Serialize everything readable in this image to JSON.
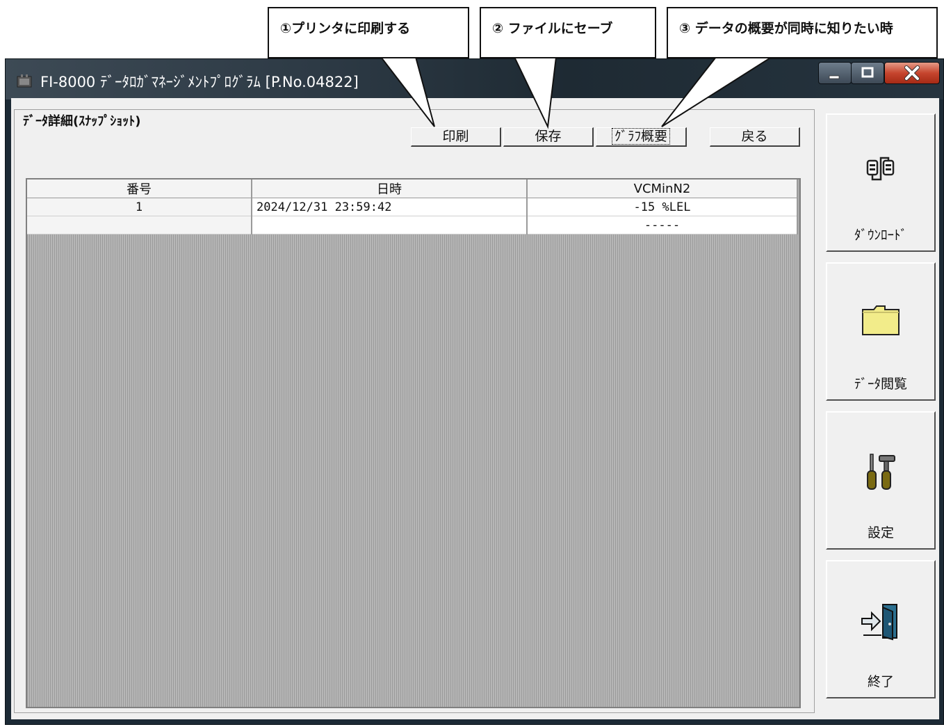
{
  "callouts": [
    {
      "label": "①プリンタに印刷する"
    },
    {
      "label": "② ファイルにセーブ"
    },
    {
      "label": "③ データの概要が同時に知りたい時"
    }
  ],
  "window": {
    "title": "FI-8000 ﾃﾞｰﾀﾛｶﾞﾏﾈｰｼﾞﾒﾝﾄﾌﾟﾛｸﾞﾗﾑ [P.No.04822]",
    "controls": [
      "minimize-icon",
      "maximize-icon",
      "close-icon"
    ]
  },
  "panel": {
    "title": "ﾃﾞｰﾀ詳細(ｽﾅｯﾌﾟｼｮｯﾄ)",
    "buttons": {
      "print": "印刷",
      "save": "保存",
      "summary": "ｸﾞﾗﾌ概要",
      "back": "戻る"
    }
  },
  "table": {
    "headers": [
      "番号",
      "日時",
      "VCMinN2"
    ],
    "rows": [
      [
        "1",
        "2024/12/31 23:59:42",
        "-15 %LEL"
      ],
      [
        "",
        "",
        "-----"
      ]
    ]
  },
  "sidebar": {
    "items": [
      {
        "label": "ﾀﾞｳﾝﾛｰﾄﾞ",
        "icon": "download-icon"
      },
      {
        "label": "ﾃﾞｰﾀ閲覧",
        "icon": "folder-icon"
      },
      {
        "label": "設定",
        "icon": "tools-icon"
      },
      {
        "label": "終了",
        "icon": "exit-door-icon"
      }
    ]
  },
  "colors": {
    "titlebar": "#2c3944",
    "face": "#f0f0f0",
    "grid_background": "#b0b0b0",
    "close_button": "#c6452e",
    "folder": "#f2ec8a"
  }
}
